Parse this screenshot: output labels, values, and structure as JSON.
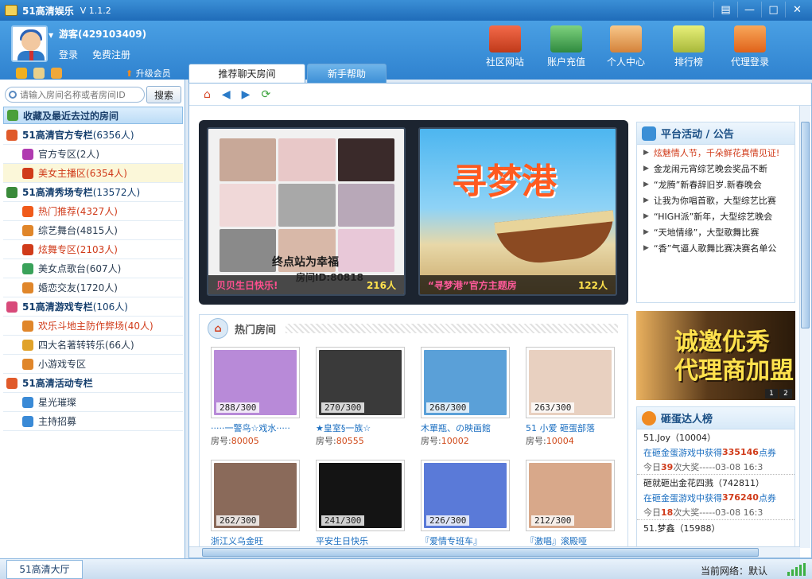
{
  "app": {
    "title": "51高清娱乐",
    "version": "V 1.1.2"
  },
  "window_buttons": [
    "▤",
    "—",
    "□",
    "✕"
  ],
  "user": {
    "name": "游客(429103409)",
    "login": "登录",
    "register": "免费注册",
    "upgrade": "升级会员"
  },
  "topnav": [
    {
      "label": "社区网站",
      "icon": "house-icon",
      "color": "#d84a2a"
    },
    {
      "label": "账户充值",
      "icon": "money-icon",
      "color": "#3aa25a"
    },
    {
      "label": "个人中心",
      "icon": "users-icon",
      "color": "#e8a24a"
    },
    {
      "label": "排行榜",
      "icon": "podium-icon",
      "color": "#c9d94a"
    },
    {
      "label": "代理登录",
      "icon": "arrow-icon",
      "color": "#f07a1a"
    }
  ],
  "tabs": {
    "active": "推荐聊天房间",
    "inactive": "新手帮助"
  },
  "search": {
    "placeholder": "请输入房间名称或者房间ID",
    "button": "搜索"
  },
  "favorites": "收藏及最近去过的房间",
  "tree": [
    {
      "type": "group",
      "label": "51高清官方专栏",
      "count": "(6356人)",
      "color": "#e05a2a"
    },
    {
      "type": "item",
      "label": "官方专区",
      "count": "(2人)",
      "color": "#b03bb0"
    },
    {
      "type": "item",
      "label": "美女主播区",
      "count": "(6354人)",
      "color": "#d03b1a",
      "hot": true,
      "selected": true
    },
    {
      "type": "group",
      "label": "51高清秀场专栏",
      "count": "(13572人)",
      "color": "#3a8a3a"
    },
    {
      "type": "item",
      "label": "热门推荐",
      "count": "(4327人)",
      "color": "#f05a1a",
      "hot": true
    },
    {
      "type": "item",
      "label": "综艺舞台",
      "count": "(4815人)",
      "color": "#e0862a"
    },
    {
      "type": "item",
      "label": "炫舞专区",
      "count": "(2103人)",
      "color": "#d03b1a",
      "hot": true
    },
    {
      "type": "item",
      "label": "美女点歌台",
      "count": "(607人)",
      "color": "#3aa25a"
    },
    {
      "type": "item",
      "label": "婚恋交友",
      "count": "(1720人)",
      "color": "#e0862a"
    },
    {
      "type": "group",
      "label": "51高清游戏专栏",
      "count": "(106人)",
      "color": "#d84a7a"
    },
    {
      "type": "item",
      "label": "欢乐斗地主防作弊场",
      "count": "(40人)",
      "color": "#e0862a",
      "hot": true
    },
    {
      "type": "item",
      "label": "四大名著转转乐",
      "count": "(66人)",
      "color": "#e0a22a"
    },
    {
      "type": "item",
      "label": "小游戏专区",
      "count": "",
      "color": "#e0862a"
    },
    {
      "type": "group",
      "label": "51高清活动专栏",
      "count": "",
      "color": "#e05a2a"
    },
    {
      "type": "item",
      "label": "星光璀璨",
      "count": "",
      "color": "#3a8ad6"
    },
    {
      "type": "item",
      "label": "主持招募",
      "count": "",
      "color": "#3a8ad6"
    }
  ],
  "banner": {
    "left": {
      "overlay": "终点站为幸福",
      "title": "贝贝生日快乐!",
      "room_id": "房间ID:80818",
      "count": "216人"
    },
    "right": {
      "overlay": "寻梦港",
      "title": "“寻梦港”官方主题房",
      "count": "122人"
    }
  },
  "notice": {
    "title": "平台活动 / 公告",
    "items": [
      {
        "text": "炫魅情人节，千朵鲜花真情见证!",
        "red": true
      },
      {
        "text": "金龙闹元宵综艺晚会奖品不断",
        "red": false
      },
      {
        "text": "“龙腾”新春辞旧岁.新春晚会",
        "red": false
      },
      {
        "text": "让我为你唱首歌，大型综艺比赛",
        "red": false
      },
      {
        "text": "“HIGH派”新年，大型综艺晚会",
        "red": false
      },
      {
        "text": "“天地情缘”，大型歌舞比赛",
        "red": false
      },
      {
        "text": "“香”气逼人歌舞比赛决赛名单公",
        "red": false
      }
    ]
  },
  "ad": {
    "line1": "诚邀优秀",
    "line2": "代理商加盟",
    "pages": [
      "1",
      "2"
    ]
  },
  "smash": {
    "title": "砸蛋达人榜",
    "lines": [
      {
        "text": "51.Joy（10004）",
        "style": "plain"
      },
      {
        "pre": "在砸金蛋游戏中获得",
        "amount": "335146",
        "post": "点券",
        "style": "blue"
      },
      {
        "pre": "今日",
        "amount": "39",
        "post": "次大奖-----03-08 16:3",
        "style": "gray"
      },
      {
        "text": "砸就砸出金花四溅（742811）",
        "style": "plain"
      },
      {
        "pre": "在砸金蛋游戏中获得",
        "amount": "376240",
        "post": "点券",
        "style": "blue"
      },
      {
        "pre": "今日",
        "amount": "18",
        "post": "次大奖-----03-08 16:3",
        "style": "gray"
      },
      {
        "text": "51.梦鑫（15988）",
        "style": "plain"
      }
    ]
  },
  "hot_rooms": {
    "title": "热门房间",
    "rooms": [
      {
        "count": "288/300",
        "name": "·····一警鸟☆戏水·····",
        "num": "80005",
        "color": "#b88ad8"
      },
      {
        "count": "270/300",
        "name": "★皇室§一族☆",
        "num": "80555",
        "color": "#3a3a3a"
      },
      {
        "count": "268/300",
        "name": "木單瓶、の映画館",
        "num": "10002",
        "color": "#5aa0d8"
      },
      {
        "count": "263/300",
        "name": "51 小爱  砸蛋部落",
        "num": "10004",
        "color": "#e8d0c0"
      },
      {
        "count": "262/300",
        "name": "浙江义乌金旺",
        "num": "",
        "color": "#8a6a5a"
      },
      {
        "count": "241/300",
        "name": "平安生日快乐",
        "num": "",
        "color": "#141414"
      },
      {
        "count": "226/300",
        "name": "『爱情专班车』",
        "num": "",
        "color": "#5a7ad8"
      },
      {
        "count": "212/300",
        "name": "『激唱』滚殿哑",
        "num": "",
        "color": "#d8a88a"
      }
    ]
  },
  "room_prefix": "房号:",
  "status": {
    "tab": "51高清大厅",
    "network_label": "当前网络：默认"
  }
}
